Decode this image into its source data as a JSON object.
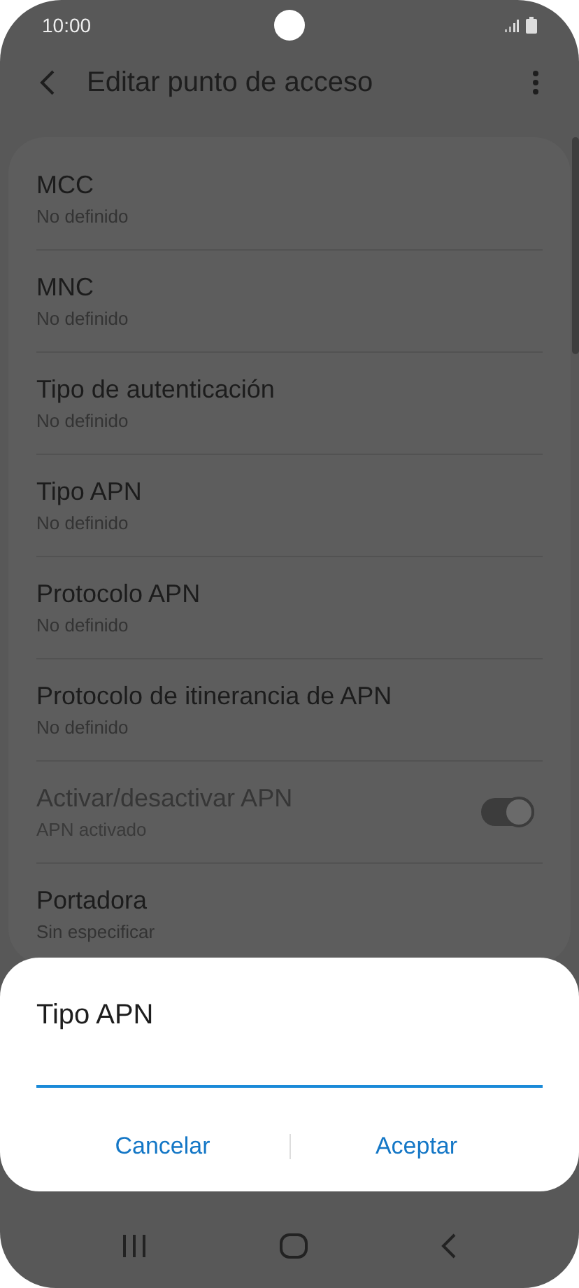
{
  "status_bar": {
    "time": "10:00"
  },
  "header": {
    "title": "Editar punto de acceso"
  },
  "settings": [
    {
      "kind": "text",
      "title": "MCC",
      "summary": "No definido",
      "disabled": false
    },
    {
      "kind": "text",
      "title": "MNC",
      "summary": "No definido",
      "disabled": false
    },
    {
      "kind": "text",
      "title": "Tipo de autenticación",
      "summary": "No definido",
      "disabled": false
    },
    {
      "kind": "text",
      "title": "Tipo APN",
      "summary": "No definido",
      "disabled": false
    },
    {
      "kind": "text",
      "title": "Protocolo APN",
      "summary": "No definido",
      "disabled": false
    },
    {
      "kind": "text",
      "title": "Protocolo de itinerancia de APN",
      "summary": "No definido",
      "disabled": false
    },
    {
      "kind": "switch",
      "title": "Activar/desactivar APN",
      "summary": "APN activado",
      "disabled": true,
      "on": true
    },
    {
      "kind": "text",
      "title": "Portadora",
      "summary": "Sin especificar",
      "disabled": false
    }
  ],
  "dialog": {
    "title": "Tipo APN",
    "buttons": [
      "Cancelar",
      "Aceptar"
    ]
  }
}
